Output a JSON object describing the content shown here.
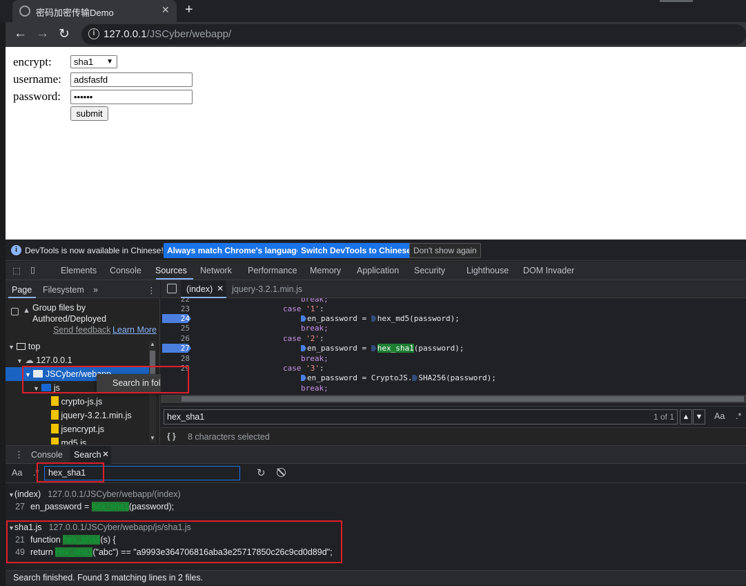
{
  "browser": {
    "tab_title": "密码加密传输Demo",
    "tab_close": "✕",
    "new_tab": "+",
    "url_host": "127.0.0.1",
    "url_path": "/JSCyber/webapp/"
  },
  "form": {
    "encrypt_label": "encrypt:",
    "encrypt_value": "sha1",
    "username_label": "username:",
    "username_value": "adsfasfd",
    "password_label": "password:",
    "password_value": "••••••",
    "submit_label": "submit"
  },
  "infobar": {
    "message": "DevTools is now available in Chinese!",
    "btn_match": "Always match Chrome's language",
    "btn_switch": "Switch DevTools to Chinese",
    "btn_dont": "Don't show again"
  },
  "devtools_tabs": [
    "Elements",
    "Console",
    "Sources",
    "Network",
    "Performance",
    "Memory",
    "Application",
    "Security",
    "Lighthouse",
    "DOM Invader"
  ],
  "navigator": {
    "tab_page": "Page",
    "tab_filesystem": "Filesystem",
    "more": "»",
    "group_label_1": "Group files by",
    "group_label_2": "Authored/Deployed",
    "send_feedback": "Send feedback",
    "learn_more": "Learn More",
    "tree": {
      "top": "top",
      "host": "127.0.0.1",
      "folder": "JSCyber/webapp",
      "js": "js",
      "files": [
        "crypto-js.js",
        "jquery-3.2.1.min.js",
        "jsencrypt.js",
        "md5.js"
      ]
    },
    "context_menu": "Search in folder"
  },
  "editor": {
    "tab_index": "(index)",
    "tab_jquery": "jquery-3.2.1.min.js",
    "lines": [
      {
        "n": "22",
        "text": "break;"
      },
      {
        "n": "23",
        "text": "case '1':"
      },
      {
        "n": "24",
        "text": "en_password = hex_md5(password);"
      },
      {
        "n": "25",
        "text": "break;"
      },
      {
        "n": "26",
        "text": "case '2':"
      },
      {
        "n": "27",
        "text": "en_password = hex_sha1(password);"
      },
      {
        "n": "28",
        "text": "break;"
      },
      {
        "n": "29",
        "text": "case '3':"
      },
      {
        "n": "",
        "text": "en_password = CryptoJS.SHA256(password);"
      },
      {
        "n": "",
        "text": "break;"
      }
    ],
    "find_query": "hex_sha1",
    "find_count": "1 of 1",
    "status": "8 characters selected"
  },
  "drawer": {
    "tab_console": "Console",
    "tab_search": "Search",
    "search_query": "hex_sha1",
    "results": [
      {
        "file": "(index)",
        "path": "127.0.0.1/JSCyber/webapp/(index)",
        "lines": [
          {
            "n": "27",
            "before": "en_password = ",
            "match": "hex_sha1",
            "after": "(password);"
          }
        ]
      },
      {
        "file": "sha1.js",
        "path": "127.0.0.1/JSCyber/webapp/js/sha1.js",
        "lines": [
          {
            "n": "21",
            "before": "function ",
            "match": "hex_sha1",
            "after": "(s) {"
          },
          {
            "n": "49",
            "before": "return ",
            "match": "hex_sha1",
            "after": "(\"abc\") == \"a9993e364706816aba3e25717850c26c9cd0d89d\";"
          }
        ]
      }
    ],
    "status": "Search finished.  Found 3 matching lines in 2 files."
  },
  "colors": {
    "accent": "#1a73e8",
    "highlight": "#1e7e34",
    "annotation_box": "#e01e2b"
  }
}
